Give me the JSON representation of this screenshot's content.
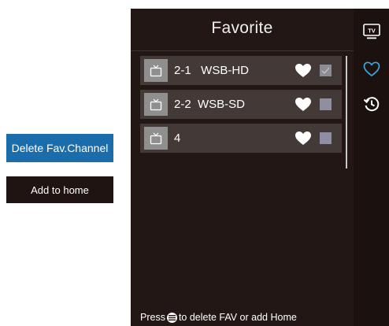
{
  "side_buttons": {
    "delete_label": "Delete Fav.Channel",
    "add_home_label": "Add to home"
  },
  "panel": {
    "title": "Favorite",
    "channels": [
      {
        "label": "2-1   WSB-HD",
        "favorite": true,
        "checked": true
      },
      {
        "label": "2-2  WSB-SD",
        "favorite": true,
        "checked": false
      },
      {
        "label": "4",
        "favorite": true,
        "checked": false
      }
    ],
    "footer_before": "Press",
    "footer_after": "to delete FAV or add Home"
  },
  "strip": {
    "icons": [
      "tv-icon",
      "heart-icon",
      "history-icon"
    ],
    "active": "heart-icon"
  },
  "colors": {
    "accent_blue": "#1a6cab",
    "active_icon": "#3aa9e0",
    "panel_bg": "#221714",
    "row_bg": "#433a37"
  }
}
